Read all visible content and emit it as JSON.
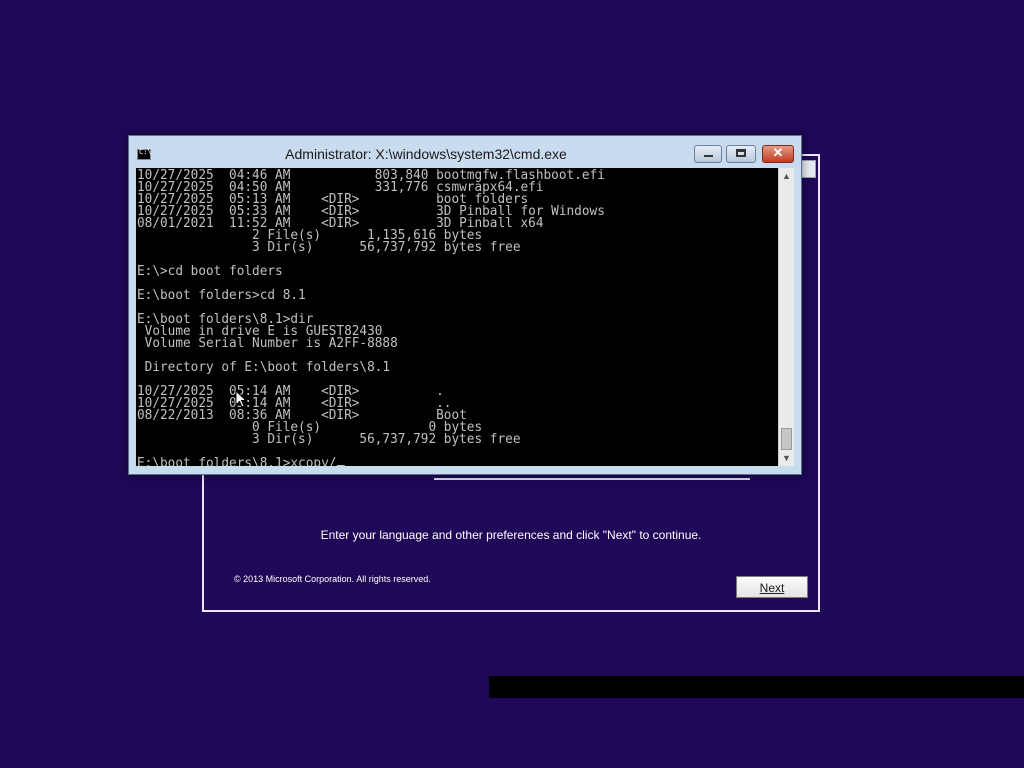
{
  "setup": {
    "instruction": "Enter your language and other preferences and click \"Next\" to continue.",
    "copyright": "© 2013 Microsoft Corporation. All rights reserved.",
    "next_label": "Next"
  },
  "cmd": {
    "title": "Administrator: X:\\windows\\system32\\cmd.exe",
    "icon_text": "C:\\",
    "buttons": {
      "minimize": "minimize-icon",
      "maximize": "maximize-icon",
      "close": "close-icon",
      "close_glyph": "✕"
    },
    "console_lines": [
      "10/27/2025  04:46 AM           803,840 bootmgfw.flashboot.efi",
      "10/27/2025  04:50 AM           331,776 csmwrapx64.efi",
      "10/27/2025  05:13 AM    <DIR>          boot folders",
      "10/27/2025  05:33 AM    <DIR>          3D Pinball for Windows",
      "08/01/2021  11:52 AM    <DIR>          3D Pinball x64",
      "               2 File(s)      1,135,616 bytes",
      "               3 Dir(s)      56,737,792 bytes free",
      "",
      "E:\\>cd boot folders",
      "",
      "E:\\boot folders>cd 8.1",
      "",
      "E:\\boot folders\\8.1>dir",
      " Volume in drive E is GUEST82430",
      " Volume Serial Number is A2FF-8888",
      "",
      " Directory of E:\\boot folders\\8.1",
      "",
      "10/27/2025  05:14 AM    <DIR>          .",
      "10/27/2025  05:14 AM    <DIR>          ..",
      "08/22/2013  08:36 AM    <DIR>          Boot",
      "               0 File(s)              0 bytes",
      "               3 Dir(s)      56,737,792 bytes free",
      "",
      "E:\\boot folders\\8.1>xcopy/"
    ],
    "scroll_up_glyph": "▲",
    "scroll_down_glyph": "▼"
  },
  "colors": {
    "desktop_bg": "#1e0857",
    "console_bg": "#000000",
    "console_fg": "#c0c0c0",
    "window_frame": "#c9dbee",
    "close_button": "#c23c22"
  },
  "icons": {
    "pointer": "mouse-pointer-icon"
  }
}
